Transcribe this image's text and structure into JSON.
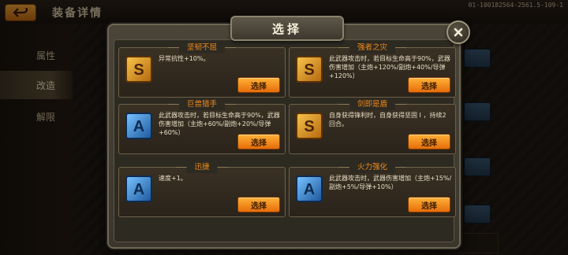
{
  "header": {
    "title": "装备详情",
    "corner_id": "01-100182564-2561.5-109-1",
    "back_icon": "back-arrow-icon"
  },
  "left_nav": {
    "items": [
      {
        "label": "属性"
      },
      {
        "label": "改造"
      },
      {
        "label": "解限"
      }
    ],
    "active_index": 1
  },
  "modal": {
    "title": "选择",
    "close_icon": "close-icon",
    "options": [
      {
        "title": "坚韧不屈",
        "grade": "S",
        "desc": "异常抗性+10%。",
        "button": "选择"
      },
      {
        "title": "强者之灾",
        "grade": "S",
        "desc": "此武器攻击时，若目标生命高于90%，武器伤害增加（主炮+120%/副炮+40%/导弹+120%）",
        "button": "选择"
      },
      {
        "title": "巨兽猎手",
        "grade": "A",
        "desc": "此武器攻击时，若目标生命高于90%，武器伤害增加（主炮+60%/副炮+20%/导弹+60%）",
        "button": "选择"
      },
      {
        "title": "剑即是盾",
        "grade": "S",
        "desc": "自身获得锋利时，自身获得坚固 I ，持续2回合。",
        "button": "选择"
      },
      {
        "title": "迅捷",
        "grade": "A",
        "desc": "速度+1。",
        "button": "选择"
      },
      {
        "title": "火力强化",
        "grade": "A",
        "desc": "此武器攻击时，武器伤害增加（主炮+15%/副炮+5%/导弹+10%）",
        "button": "选择"
      }
    ]
  },
  "colors": {
    "accent_orange": "#f08a1a",
    "button_orange": "#ffb237",
    "badge_s_gold": "#f6c24a",
    "badge_a_blue": "#77c2ff"
  }
}
